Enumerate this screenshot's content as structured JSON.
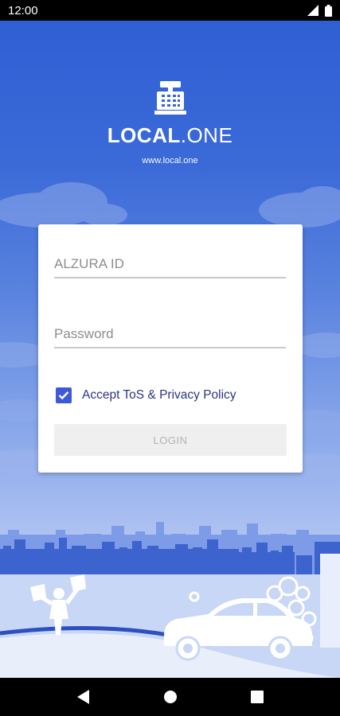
{
  "status_bar": {
    "time": "12:00"
  },
  "app": {
    "brand_bold": "LOCAL",
    "brand_light": ".ONE",
    "url": "www.local.one"
  },
  "login": {
    "id_placeholder": "ALZURA ID",
    "password_placeholder": "Password",
    "tos_label": "Accept ToS & Privacy Policy",
    "tos_checked": true,
    "button_label": "LOGIN"
  },
  "icons": {
    "status": [
      "signal-icon",
      "battery-icon"
    ],
    "logo": "cash-register-icon",
    "nav": [
      "back-icon",
      "home-icon",
      "recents-icon"
    ]
  },
  "colors": {
    "accent": "#3f58d8",
    "background_top": "#2f5fd4",
    "background_bottom": "#c8d6f5"
  }
}
